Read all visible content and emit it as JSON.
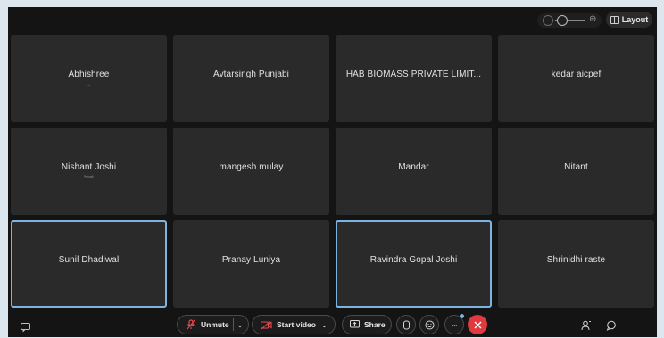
{
  "meeting": {
    "participants": [
      {
        "name": "Abhishree",
        "sub": "...",
        "active": false
      },
      {
        "name": "Avtarsingh Punjabi",
        "sub": "",
        "active": false
      },
      {
        "name": "HAB BIOMASS PRIVATE LIMIT...",
        "sub": "",
        "active": false
      },
      {
        "name": "kedar aicpef",
        "sub": "",
        "active": false
      },
      {
        "name": "Nishant Joshi",
        "sub": "Host",
        "active": false
      },
      {
        "name": "mangesh mulay",
        "sub": "",
        "active": false
      },
      {
        "name": "Mandar",
        "sub": "",
        "active": false
      },
      {
        "name": "Nitant",
        "sub": "",
        "active": false
      },
      {
        "name": "Sunil Dhadiwal",
        "sub": "",
        "active": true
      },
      {
        "name": "Pranay Luniya",
        "sub": "",
        "active": false
      },
      {
        "name": "Ravindra Gopal Joshi",
        "sub": "",
        "active": true
      },
      {
        "name": "Shrinidhi raste",
        "sub": "",
        "active": false
      }
    ]
  },
  "toolbar": {
    "layout_label": "Layout",
    "unmute_label": "Unmute",
    "start_video_label": "Start video",
    "share_label": "Share",
    "more_label": "···"
  },
  "colors": {
    "accent_blue": "#7eb3e0",
    "mic_red": "#e5484d",
    "end_red": "#e0393e",
    "background": "#141414",
    "tile": "#2a2a2a"
  },
  "icons": [
    "chat-icon",
    "mic-muted-icon",
    "video-off-icon",
    "share-icon",
    "hand-icon",
    "emoji-icon",
    "more-icon",
    "end-call-icon",
    "participants-icon",
    "messages-icon",
    "layout-icon",
    "zoom-slider"
  ]
}
